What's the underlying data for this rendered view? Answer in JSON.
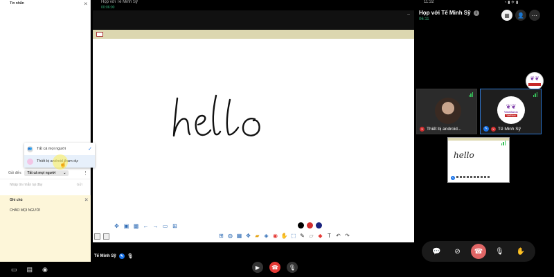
{
  "chat": {
    "title": "Tin nhắn",
    "recipient_menu": {
      "everyone": "Tất cả mọi người",
      "android_device": "Thiết bị android tham dự"
    },
    "send_to_label": "Gửi đến:",
    "send_to_value": "Tất cả mọi người",
    "input_placeholder": "Nhập tin nhắn tại đây",
    "send_label": "Gửi"
  },
  "notes": {
    "title": "Ghi chú",
    "content": "CHÀO MỌI NGƯỜI"
  },
  "meeting": {
    "small_title": "Họp với Tế Minh Sỹ",
    "small_timer": "00:06:00",
    "presenter_name": "Tế Minh Sỹ"
  },
  "whiteboard": {
    "handwritten_text": "hello",
    "pen_colors": [
      "#000000",
      "#d32f2f",
      "#1a237e"
    ]
  },
  "right_panel": {
    "clock": "11:32",
    "title": "Họp với Tế Minh Sỹ",
    "duration": "06:11",
    "participants": [
      {
        "name": "Thiết bị android...",
        "muted": true
      },
      {
        "name": "Tế Minh Sỹ",
        "muted": true,
        "active": true
      }
    ],
    "logo_brand": "ViewSonic",
    "logo_country": "VietNam",
    "mini_whiteboard_text": "hello"
  }
}
